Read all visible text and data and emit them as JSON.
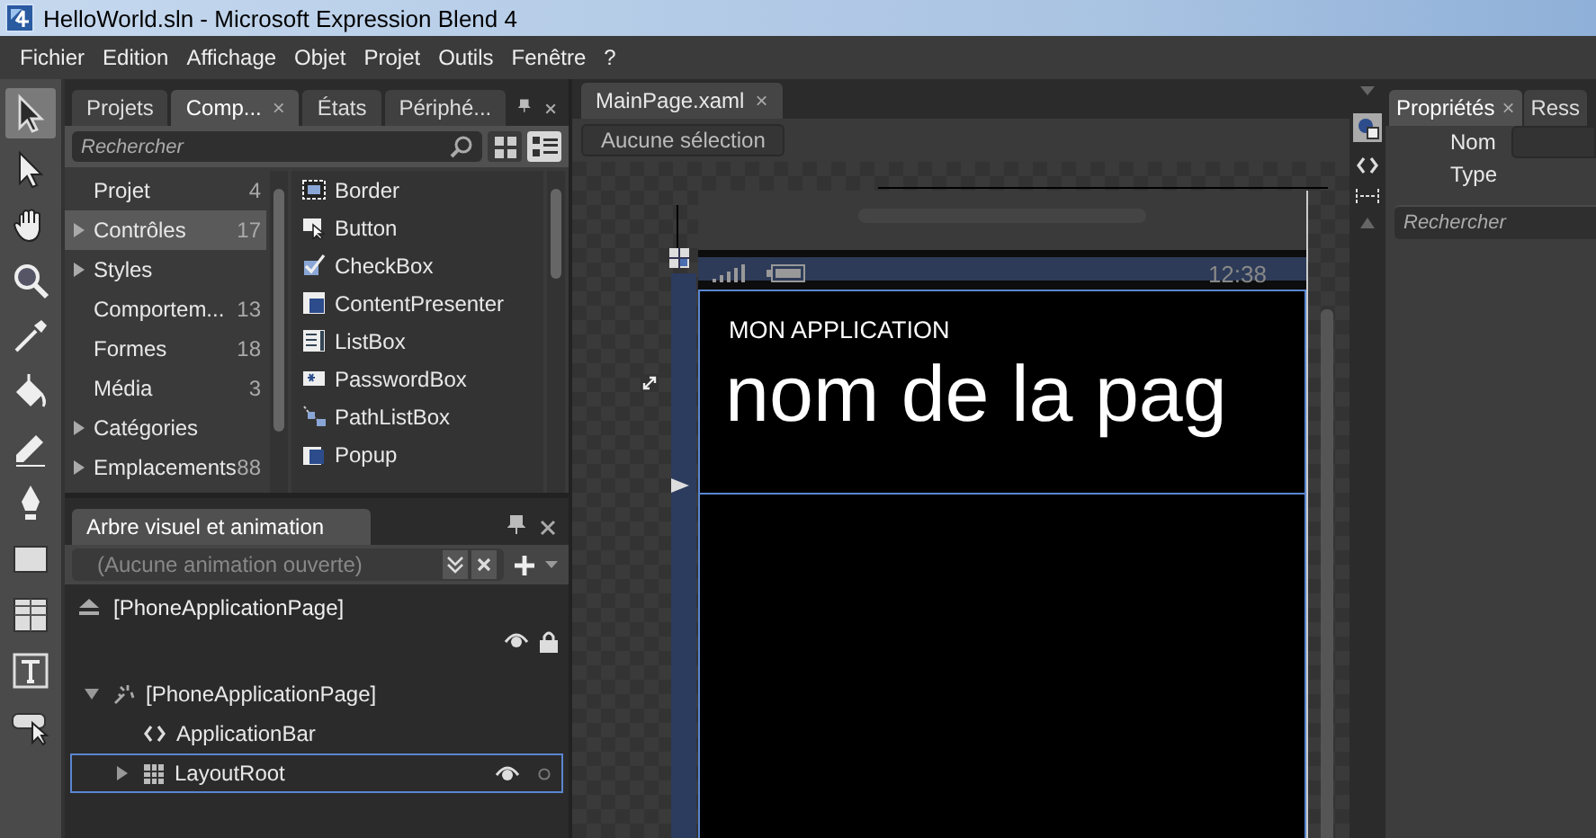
{
  "window": {
    "title": "HelloWorld.sln - Microsoft Expression Blend 4"
  },
  "menu": [
    "Fichier",
    "Edition",
    "Affichage",
    "Objet",
    "Projet",
    "Outils",
    "Fenêtre",
    "?"
  ],
  "tools": [
    {
      "kind": "select",
      "selected": true
    },
    {
      "kind": "direct",
      "selected": false
    },
    {
      "kind": "hand",
      "selected": false
    },
    {
      "kind": "zoom",
      "selected": false
    },
    {
      "kind": "dropper",
      "selected": false
    },
    {
      "kind": "bucket",
      "selected": false
    },
    {
      "kind": "pencil",
      "selected": false
    },
    {
      "kind": "pen",
      "selected": false
    },
    {
      "kind": "rect",
      "selected": false
    },
    {
      "kind": "grid",
      "selected": false
    },
    {
      "kind": "text",
      "selected": false
    },
    {
      "kind": "control",
      "selected": false
    }
  ],
  "assets_panel": {
    "tabs": [
      {
        "label": "Projets",
        "selected": false
      },
      {
        "label": "Comp...",
        "selected": true,
        "close": "×"
      },
      {
        "label": "États",
        "selected": false
      },
      {
        "label": "Périphé...",
        "selected": false
      }
    ],
    "search": {
      "placeholder": "Rechercher"
    },
    "view_buttons": [
      {
        "kind": "grid",
        "selected": false
      },
      {
        "kind": "list",
        "selected": true
      }
    ],
    "categories": [
      {
        "label": "Projet",
        "count": "4",
        "selected": false
      },
      {
        "label": "Contrôles",
        "count": "17",
        "expanded": false,
        "selected": true
      },
      {
        "label": "Styles",
        "expanded": false,
        "selected": false
      },
      {
        "label": "Comportem...",
        "count": "13",
        "selected": false
      },
      {
        "label": "Formes",
        "count": "18",
        "selected": false
      },
      {
        "label": "Média",
        "count": "3",
        "selected": false
      },
      {
        "label": "Catégories",
        "expanded": false,
        "selected": false
      },
      {
        "label": "Emplacements",
        "count": "88",
        "expanded": false,
        "selected": false
      }
    ],
    "items": [
      {
        "label": "Border",
        "kind": "border"
      },
      {
        "label": "Button",
        "kind": "button"
      },
      {
        "label": "CheckBox",
        "kind": "checkbox"
      },
      {
        "label": "ContentPresenter",
        "kind": "presenter"
      },
      {
        "label": "ListBox",
        "kind": "listbox"
      },
      {
        "label": "PasswordBox",
        "kind": "password"
      },
      {
        "label": "PathListBox",
        "kind": "path"
      },
      {
        "label": "Popup",
        "kind": "popup"
      }
    ]
  },
  "objects_panel": {
    "title": "Arbre visuel et animation",
    "animation": {
      "placeholder": "(Aucune animation ouverte)"
    },
    "scope": "[PhoneApplicationPage]",
    "tree": [
      {
        "label": "[PhoneApplicationPage]",
        "kind": "page",
        "expanded": true,
        "selected": false,
        "children": [
          {
            "label": "ApplicationBar",
            "kind": "appbar",
            "selected": false
          },
          {
            "label": "LayoutRoot",
            "kind": "grid",
            "expanded": false,
            "selected": true
          }
        ]
      }
    ]
  },
  "document": {
    "tab": "MainPage.xaml",
    "tab_close": "×",
    "breadcrumb": "Aucune sélection",
    "phone": {
      "time": "12:38",
      "app_title": "MON APPLICATION",
      "page_title": "nom de la pag"
    }
  },
  "properties_panel": {
    "tabs": [
      {
        "label": "Propriétés",
        "selected": true,
        "close": "×"
      },
      {
        "label": "Ress",
        "selected": false
      }
    ],
    "fields": [
      {
        "label": "Nom",
        "kind": "input"
      },
      {
        "label": "Type",
        "kind": "text"
      }
    ],
    "search": {
      "placeholder": "Rechercher"
    }
  }
}
